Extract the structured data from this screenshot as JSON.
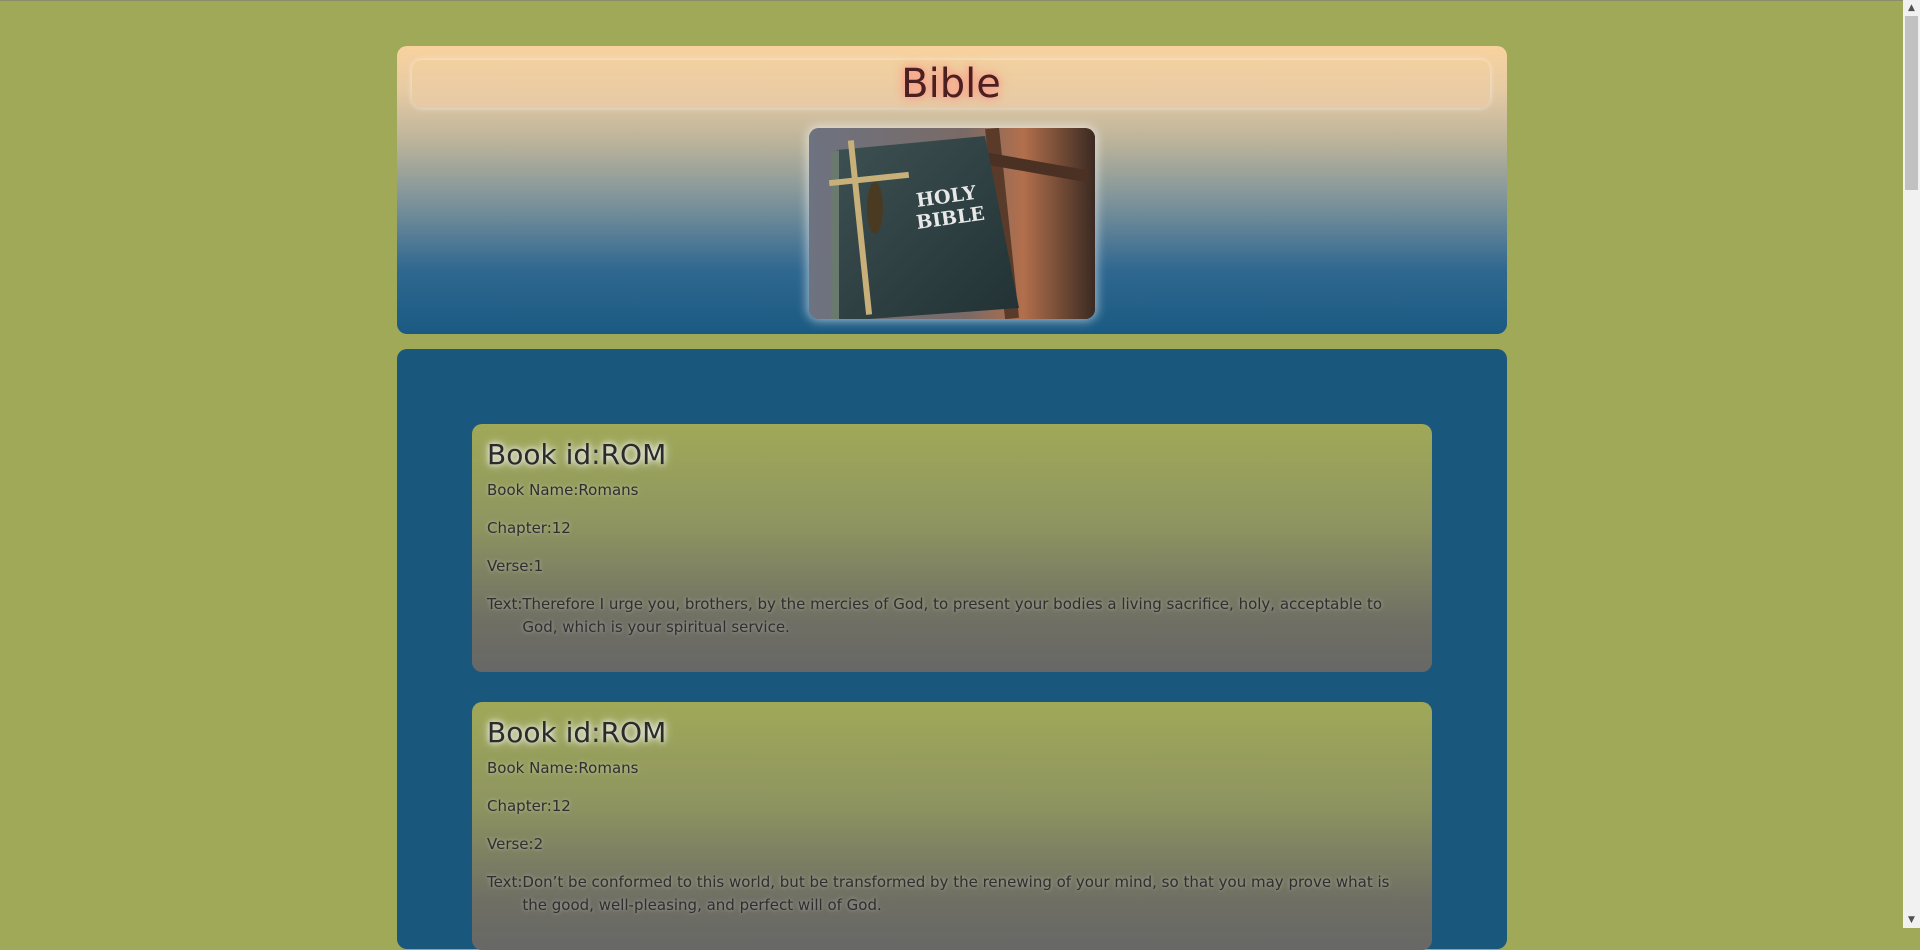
{
  "header": {
    "title": "Bible",
    "cover_alt": "HOLY BIBLE",
    "cover_text_line1": "HOLY",
    "cover_text_line2": "BIBLE"
  },
  "labels": {
    "book_id": "Book id:",
    "book_name": "Book Name:",
    "chapter": "Chapter:",
    "verse": "Verse:",
    "text": "Text:"
  },
  "verses": [
    {
      "book_id": "ROM",
      "book_name": "Romans",
      "chapter": "12",
      "verse": "1",
      "text": "Therefore I urge you, brothers, by the mercies of God, to present your bodies a living sacrifice, holy, acceptable to God, which is your spiritual service."
    },
    {
      "book_id": "ROM",
      "book_name": "Romans",
      "chapter": "12",
      "verse": "2",
      "text": "Don’t be conformed to this world, but be transformed by the renewing of your mind, so that you may prove what is the good, well-pleasing, and perfect will of God."
    }
  ],
  "scrollbar": {
    "up_icon": "scroll-up-arrow-icon",
    "down_icon": "scroll-down-arrow-icon"
  }
}
